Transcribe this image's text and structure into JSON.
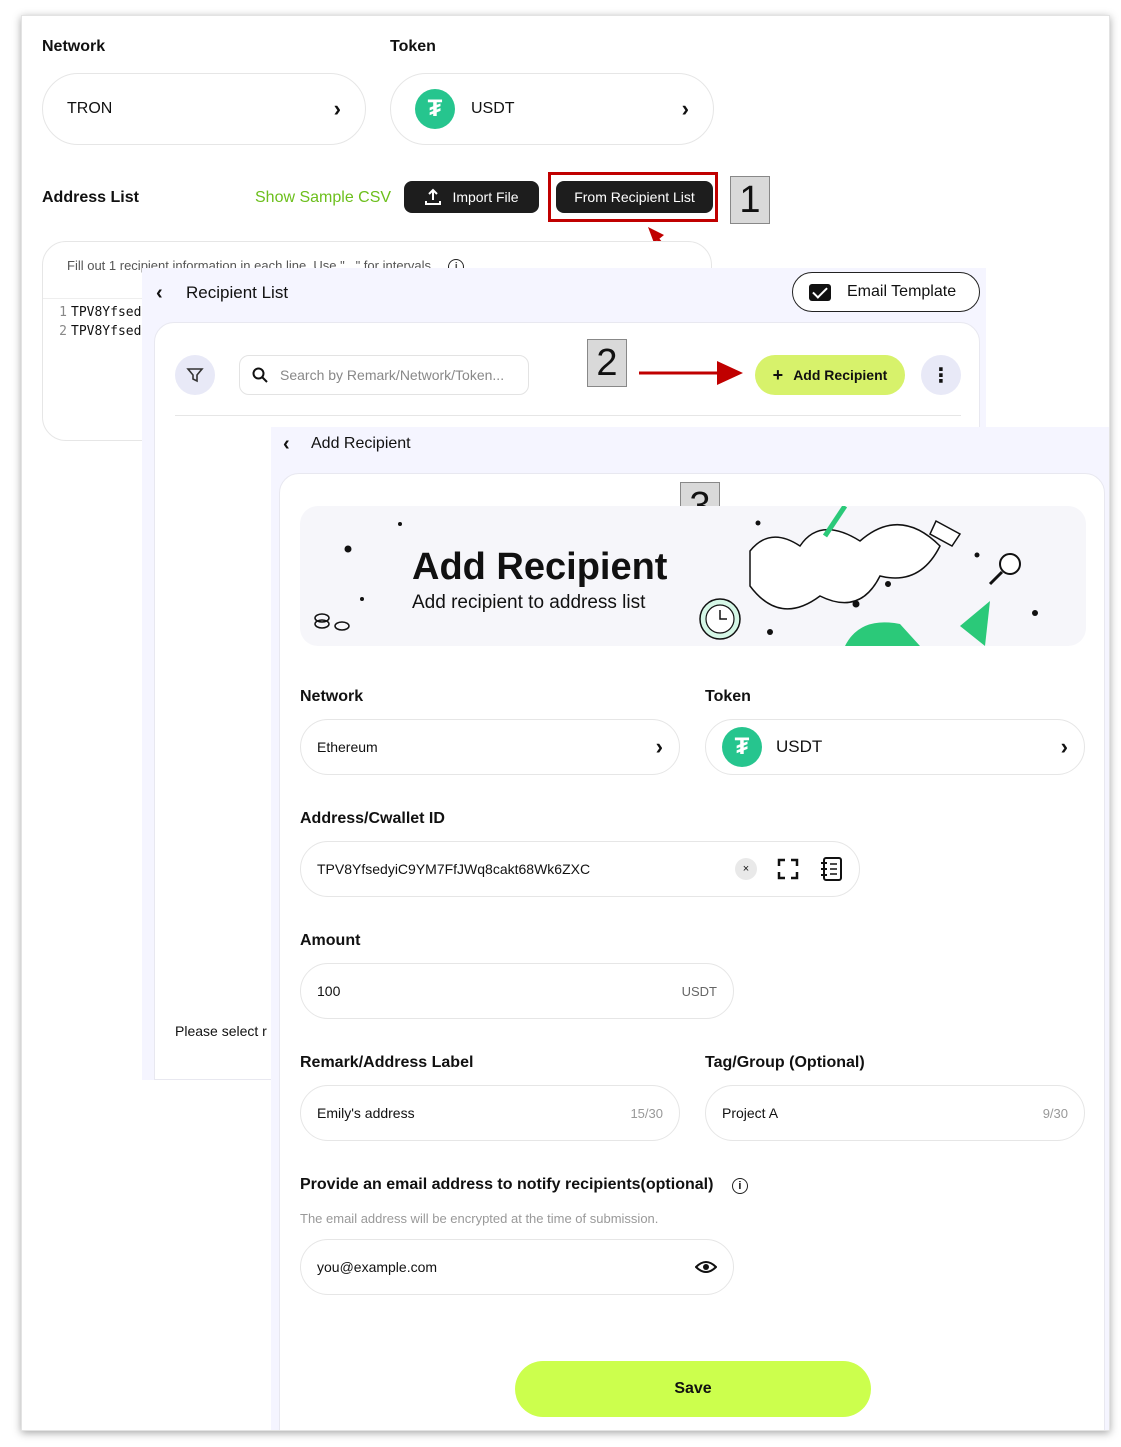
{
  "screen1": {
    "network_label": "Network",
    "network_value": "TRON",
    "token_label": "Token",
    "token_value": "USDT",
    "address_list_label": "Address List",
    "show_sample_csv": "Show Sample CSV",
    "import_file": "Import File",
    "from_recipient_list": "From Recipient List",
    "textarea_hint": "Fill out 1 recipient information in each line. Use \" , \" for intervals.",
    "lines": [
      {
        "num": "1",
        "text": "TPV8Yfsed"
      },
      {
        "num": "2",
        "text": "TPV8Yfsed"
      }
    ]
  },
  "steps": {
    "step1": "1",
    "step2": "2",
    "step3": "3"
  },
  "screen2": {
    "title": "Recipient List",
    "email_template": "Email Template",
    "search_placeholder": "Search by Remark/Network/Token...",
    "add_recipient": "Add Recipient",
    "please_select": "Please select r"
  },
  "screen3": {
    "title": "Add Recipient",
    "banner_title": "Add Recipient",
    "banner_subtitle": "Add recipient to address list",
    "network_label": "Network",
    "network_value": "Ethereum",
    "token_label": "Token",
    "token_value": "USDT",
    "address_label": "Address/Cwallet ID",
    "address_value": "TPV8YfsedyiC9YM7FfJWq8cakt68Wk6ZXC",
    "amount_label": "Amount",
    "amount_value": "100",
    "amount_unit": "USDT",
    "remark_label": "Remark/Address Label",
    "remark_value": "Emily's address",
    "remark_counter": "15/30",
    "tag_label": "Tag/Group (Optional)",
    "tag_value": "Project A",
    "tag_counter": "9/30",
    "email_label": "Provide an email address to notify recipients(optional)",
    "email_note": "The email address will be encrypted at the time of submission.",
    "email_placeholder": "you@example.com",
    "save": "Save"
  },
  "colors": {
    "accent_green": "#ccff4d",
    "add_btn": "#d7f26b",
    "tether": "#26c58e",
    "highlight_red": "#c00000",
    "link_green": "#6cbf1c"
  }
}
